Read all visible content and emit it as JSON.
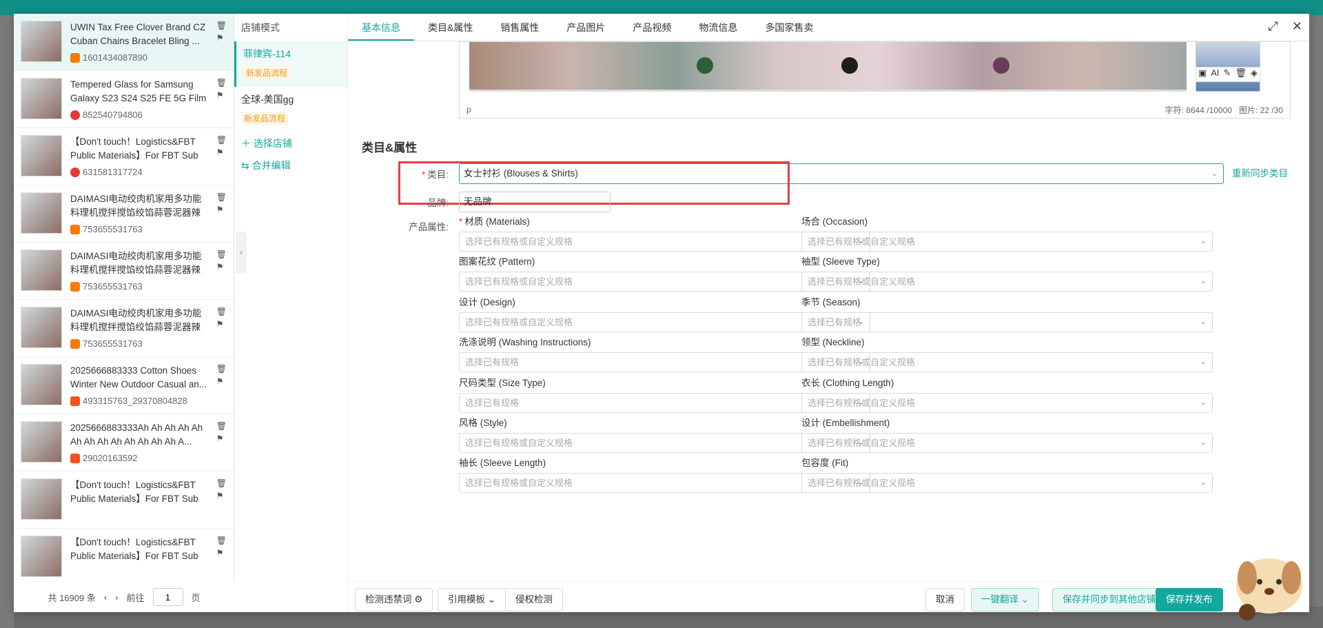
{
  "products": [
    {
      "title": "UWIN Tax Free Clover Brand CZ Cuban Chains Bracelet Bling ...",
      "id": "1601434087890",
      "badge": "orange",
      "active": true
    },
    {
      "title": "Tempered Glass for Samsung Galaxy S23 S24 S25 FE 5G Film",
      "id": "852540794806",
      "badge": "red",
      "active": false
    },
    {
      "title": "【Don't touch！Logistics&FBT Public Materials】For FBT Sub ...",
      "id": "631581317724",
      "badge": "red",
      "active": false
    },
    {
      "title": "DAIMASI电动绞肉机家用多功能料理机搅拌搅馅绞馅蒜蓉泥器辣椒",
      "id": "753655531763",
      "badge": "orange",
      "active": false
    },
    {
      "title": "DAIMASI电动绞肉机家用多功能料理机搅拌搅馅绞馅蒜蓉泥器辣椒",
      "id": "753655531763",
      "badge": "orange",
      "active": false
    },
    {
      "title": "DAIMASI电动绞肉机家用多功能料理机搅拌搅馅绞馅蒜蓉泥器辣椒",
      "id": "753655531763",
      "badge": "orange",
      "active": false
    },
    {
      "title": "2025666883333 Cotton Shoes Winter New Outdoor Casual an...",
      "id": "493315763_29370804828",
      "badge": "shop",
      "active": false
    },
    {
      "title": "2025666883333Ah Ah Ah Ah Ah Ah Ah Ah Ah Ah Ah Ah Ah A...",
      "id": "29020163592",
      "badge": "shop",
      "active": false
    },
    {
      "title": "【Don't touch！Logistics&FBT Public Materials】For FBT Sub ...",
      "id": "",
      "badge": "",
      "active": false
    },
    {
      "title": "【Don't touch！Logistics&FBT Public Materials】For FBT Sub ...",
      "id": "",
      "badge": "",
      "active": false
    }
  ],
  "pager": {
    "total": "共 16909 条",
    "goto": "前往",
    "page": "1",
    "suffix": "页",
    "prev": "‹",
    "next": "›"
  },
  "stores": {
    "header": "店铺模式",
    "items": [
      {
        "name": "菲律宾-114",
        "tag": "新发品流程"
      },
      {
        "name": "全球-美国gg",
        "tag": "新发品流程"
      }
    ],
    "select_store": "选择店铺",
    "merge_edit": "合并编辑"
  },
  "tabs": [
    "基本信息",
    "类目&属性",
    "销售属性",
    "产品图片",
    "产品视频",
    "物流信息",
    "多国家售卖"
  ],
  "image_footer": {
    "left": "p",
    "chars": "字符:   8644 /10000",
    "images": "图片:   22 /30"
  },
  "image_tool_labels": [
    "AI"
  ],
  "section_title": "类目&属性",
  "category": {
    "label": "类目:",
    "value": "女士衬衫 (Blouses & Shirts)",
    "resync": "重新同步类目"
  },
  "brand": {
    "label": "品牌:",
    "value": "无品牌"
  },
  "attrs_label": "产品属性:",
  "attributes": [
    {
      "name": "材质 (Materials)",
      "placeholder": "选择已有规格或自定义规格",
      "required": true
    },
    {
      "name": "场合 (Occasion)",
      "placeholder": "选择已有规格或自定义规格",
      "required": false
    },
    {
      "name": "图案花纹 (Pattern)",
      "placeholder": "选择已有规格或自定义规格",
      "required": false
    },
    {
      "name": "袖型 (Sleeve Type)",
      "placeholder": "选择已有规格或自定义规格",
      "required": false
    },
    {
      "name": "设计 (Design)",
      "placeholder": "选择已有规格或自定义规格",
      "required": false
    },
    {
      "name": "季节 (Season)",
      "placeholder": "选择已有规格",
      "required": false
    },
    {
      "name": "洗涤说明 (Washing Instructions)",
      "placeholder": "选择已有规格",
      "required": false
    },
    {
      "name": "领型 (Neckline)",
      "placeholder": "选择已有规格或自定义规格",
      "required": false
    },
    {
      "name": "尺码类型 (Size Type)",
      "placeholder": "选择已有规格",
      "required": false
    },
    {
      "name": "衣长 (Clothing Length)",
      "placeholder": "选择已有规格或自定义规格",
      "required": false
    },
    {
      "name": "风格 (Style)",
      "placeholder": "选择已有规格或自定义规格",
      "required": false
    },
    {
      "name": "设计 (Embellishment)",
      "placeholder": "选择已有规格或自定义规格",
      "required": false
    },
    {
      "name": "袖长 (Sleeve Length)",
      "placeholder": "选择已有规格或自定义规格",
      "required": false
    },
    {
      "name": "包容度 (Fit)",
      "placeholder": "选择已有规格或自定义规格",
      "required": false
    }
  ],
  "bottom": {
    "detect": "检测违禁词",
    "template": "引用模板",
    "infringe": "侵权检测",
    "cancel": "取消",
    "translate": "一键翻译",
    "save_sync": "保存并同步到其他店铺",
    "save_publish": "保存并发布"
  },
  "colors": {
    "accent": "#14a79d",
    "highlight": "#e53e3e"
  }
}
